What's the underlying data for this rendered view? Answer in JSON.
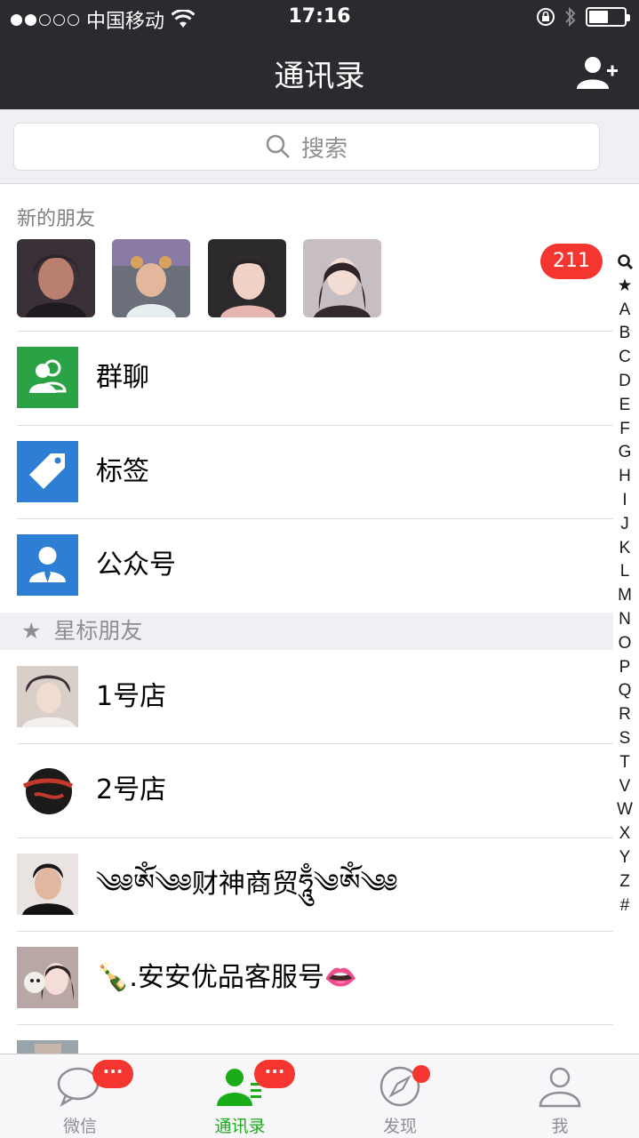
{
  "status_bar": {
    "carrier": "中国移动",
    "time": "17:16",
    "signal_dots": 5,
    "signal_filled": 2,
    "battery_level": 0.5
  },
  "nav": {
    "title": "通讯录",
    "add_icon": "add-contact-icon"
  },
  "search": {
    "placeholder": "搜索"
  },
  "new_friends": {
    "label": "新的朋友",
    "badge": "211"
  },
  "function_rows": [
    {
      "label": "群聊",
      "icon": "group-chat-icon",
      "color": "#2ba245"
    },
    {
      "label": "标签",
      "icon": "tag-icon",
      "color": "#2d7fd6"
    },
    {
      "label": "公众号",
      "icon": "official-account-icon",
      "color": "#2d7fd6"
    }
  ],
  "starred": {
    "header": "星标朋友",
    "header_icon": "star-icon",
    "contacts": [
      {
        "name": "1号店"
      },
      {
        "name": "2号店"
      },
      {
        "name": "༄༅ཨོཾ༄༅财神商贸ཧཱུྃ༄ཨོཾ༄༅"
      },
      {
        "name": "🍾.安安优品客服号👄"
      }
    ]
  },
  "index_bar": [
    "🔍",
    "★",
    "A",
    "B",
    "C",
    "D",
    "E",
    "F",
    "G",
    "H",
    "I",
    "J",
    "K",
    "L",
    "M",
    "N",
    "O",
    "P",
    "Q",
    "R",
    "S",
    "T",
    "V",
    "W",
    "X",
    "Y",
    "Z",
    "#"
  ],
  "tabs": [
    {
      "label": "微信",
      "icon": "chat-bubble-icon",
      "badge": "···",
      "active": false
    },
    {
      "label": "通讯录",
      "icon": "contacts-icon",
      "badge": "···",
      "active": true
    },
    {
      "label": "发现",
      "icon": "compass-icon",
      "badge": "",
      "dot": true,
      "active": false
    },
    {
      "label": "我",
      "icon": "person-icon",
      "badge": "",
      "active": false
    }
  ],
  "colors": {
    "nav_bg": "#2b2b2f",
    "accent_green": "#1aad19",
    "badge_red": "#f43530",
    "section_bg": "#efeff4"
  }
}
